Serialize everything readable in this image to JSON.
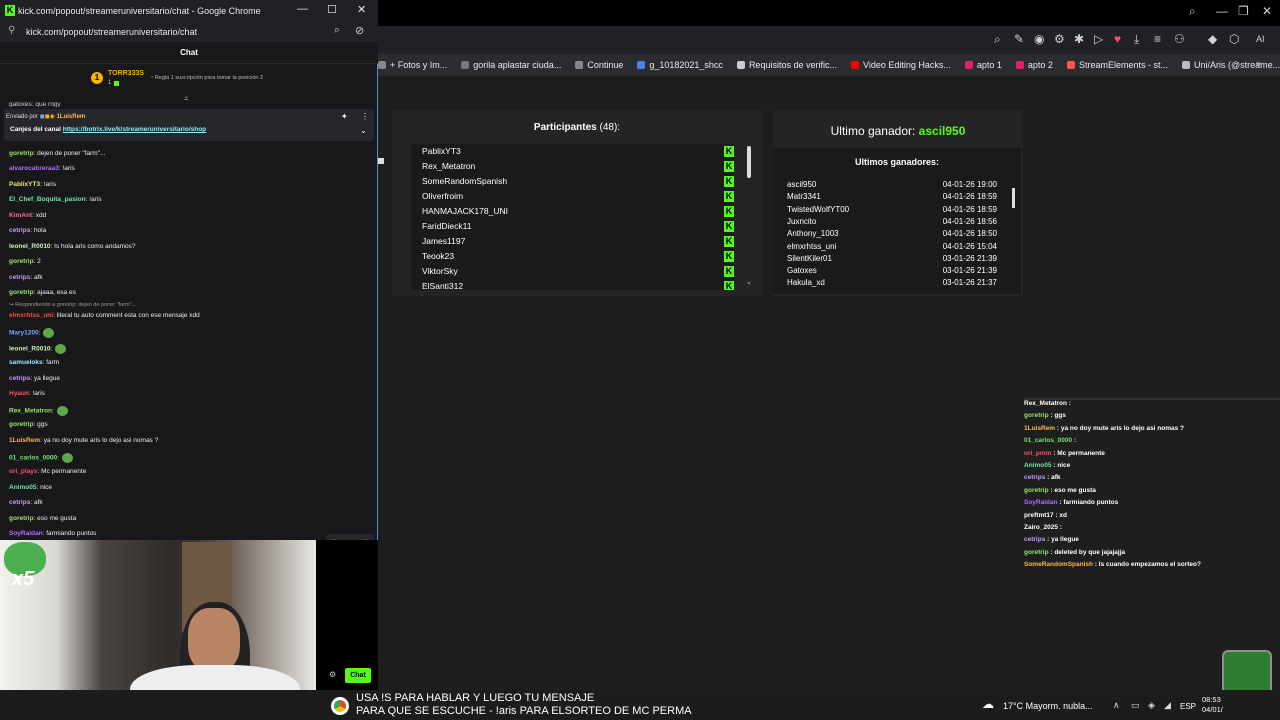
{
  "main_window": {
    "bookmarks": [
      "+ Fotos y Im...",
      "gorila aplastar ciuda...",
      "Continue",
      "g_10182021_shcc",
      "Requisitos de verific...",
      "Video Editing Hacks...",
      "apto 1",
      "apto 2",
      "StreamElements - st...",
      "Uni/Aris (@streame..."
    ],
    "bookmark_colors": [
      "#888888",
      "#777777",
      "#888888",
      "#4285f4",
      "#cccccc",
      "#ff0000",
      "#e91e63",
      "#e91e63",
      "#ff5252",
      "#bbbbbb"
    ],
    "ai_label": "AI"
  },
  "popup": {
    "title": "kick.com/popout/streameruniversitario/chat - Google Chrome",
    "url": "kick.com/popout/streameruniversitario/chat",
    "chat_header": "Chat",
    "top_user": "TORR333S",
    "top_user_count": "1",
    "rule": "Regla 1 suscripción para tomar la posición 2",
    "partial_top": "gatoxes: que rngy",
    "pinned_sent_by": "Enviado por",
    "pinned_user": "1LuisRem",
    "pinned_text": "Canjes del canal ",
    "pinned_link": "https://botrix.live/k/streameruniversitario/shop",
    "reply_note": "Respondiendo a goretrip: dejen de poner \"farm\"...",
    "chat_button": "Chat",
    "messages": [
      {
        "user": "goretrip",
        "text": ": dejen de poner \"farm\"...",
        "color": "#9ae36a"
      },
      {
        "user": "alvarocabreraa3",
        "text": ": !aris",
        "color": "#b36bff"
      },
      {
        "user": "PablixYT3",
        "text": ": !aris",
        "color": "#e7e76a"
      },
      {
        "user": "El_Chef_Boquita_pasion",
        "text": ": !aris",
        "color": "#6ee7a6"
      },
      {
        "user": "KimAnt",
        "text": ": xdd",
        "color": "#ff6b9a"
      },
      {
        "user": "cetrips",
        "text": ": hola",
        "color": "#c49bff"
      },
      {
        "user": "leonel_R0010",
        "text": ": Is hola aris como andamos?",
        "color": "#c7f7a8"
      },
      {
        "user": "goretrip",
        "text": ": 2",
        "color": "#9ae36a"
      },
      {
        "user": "cetrips",
        "text": ": afk",
        "color": "#c49bff"
      },
      {
        "user": "goretrip",
        "text": ": ajaaa, esa es",
        "color": "#9ae36a"
      },
      {
        "user": "elmxrhtss_uni",
        "text": ": literal tu auto comment esta con ese mensaje xdd",
        "color": "#ff4d4d"
      },
      {
        "user": "Mary1200",
        "text": ":",
        "color": "#6fa8ff"
      },
      {
        "user": "leonel_R0010",
        "text": ":",
        "color": "#c7f7a8"
      },
      {
        "user": "samueloks",
        "text": ": farm",
        "color": "#9ee6ff"
      },
      {
        "user": "cetrips",
        "text": ": ya llegue",
        "color": "#c49bff"
      },
      {
        "user": "Hyaun",
        "text": ": !aris",
        "color": "#ff4d6d"
      },
      {
        "user": "Rex_Metatron",
        "text": ":",
        "color": "#9ae36a"
      },
      {
        "user": "goretrip",
        "text": ": ggs",
        "color": "#9ae36a"
      },
      {
        "user": "1LuisRem",
        "text": ": ya no doy mute aris lo dejo asi nomas ?",
        "color": "#ffb84d"
      },
      {
        "user": "01_carlos_0000",
        "text": ":",
        "color": "#6ee76e"
      },
      {
        "user": "uri_plays",
        "text": ": Mc permanente",
        "color": "#ff4d6d"
      },
      {
        "user": "Animo05",
        "text": ": nice",
        "color": "#6ee7a6"
      },
      {
        "user": "cetrips",
        "text": ": afk",
        "color": "#c49bff"
      },
      {
        "user": "goretrip",
        "text": ": eso me gusta",
        "color": "#9ae36a"
      },
      {
        "user": "SoyRaidan",
        "text": ": farmiando puntos",
        "color": "#b36bff"
      }
    ]
  },
  "raffle": {
    "participants_title": "Participantes",
    "participants_count": "(48):",
    "participants": [
      "PablixYT3",
      "Rex_Metatron",
      "SomeRandomSpanish",
      "Oliverfroim",
      "HANMAJACK178_UNI",
      "FaridDieck11",
      "James1197",
      "Teook23",
      "ViktorSky",
      "ElSanti312"
    ],
    "last_winner_label": "Ultimo ganador:",
    "last_winner": "ascil950",
    "winners_title": "Ultimos ganadores:",
    "winners": [
      {
        "name": "ascil950",
        "date": "04-01-26 19:00"
      },
      {
        "name": "Matr3341",
        "date": "04-01-26 18:59"
      },
      {
        "name": "TwistedWolfYT00",
        "date": "04-01-26 18:59"
      },
      {
        "name": "Juxncito",
        "date": "04-01-26 18:56"
      },
      {
        "name": "Anthony_1003",
        "date": "04-01-26 18:50"
      },
      {
        "name": "elmxrhtss_uni",
        "date": "04-01-26 15:04"
      },
      {
        "name": "SilentKiler01",
        "date": "03-01-26 21:39"
      },
      {
        "name": "Gatoxes",
        "date": "03-01-26 21:39"
      },
      {
        "name": "Hakula_xd",
        "date": "03-01-26 21:37"
      }
    ]
  },
  "overlay_chat": [
    {
      "user": "Rex_Metatron",
      "text": " :",
      "color": "#ffffff"
    },
    {
      "user": "goretrip",
      "text": " : ggs",
      "color": "#9ae36a"
    },
    {
      "user": "1LuisRem",
      "text": " : ya no doy mute aris lo dejo asi nomas ?",
      "color": "#ffb84d"
    },
    {
      "user": "01_carlos_0000",
      "text": " :",
      "color": "#6ee76e"
    },
    {
      "user": "uri_pmm",
      "text": " : Mc permanente",
      "color": "#ff4d6d"
    },
    {
      "user": "Animo05",
      "text": " : nice",
      "color": "#6ee7a6"
    },
    {
      "user": "cetrips",
      "text": " : afk",
      "color": "#c49bff"
    },
    {
      "user": "goretrip",
      "text": " : eso me gusta",
      "color": "#9ae36a"
    },
    {
      "user": "SoyRaidan",
      "text": " : farmiando puntos",
      "color": "#b36bff"
    },
    {
      "user": "preftmt17",
      "text": " : xd",
      "color": "#ffffff"
    },
    {
      "user": "Zairo_2025",
      "text": " :",
      "color": "#ffffff"
    },
    {
      "user": "cetrips",
      "text": " : ya llegue",
      "color": "#c49bff"
    },
    {
      "user": "goretrip",
      "text": " : deleted by que jajajajja",
      "color": "#9ae36a"
    },
    {
      "user": "SomeRandomSpanish",
      "text": " : Is cuando empezamos el sorteo?",
      "color": "#ffb84d"
    }
  ],
  "webcam": {
    "multiplier": "x5"
  },
  "subtitles": "USA !S PARA HABLAR Y LUEGO TU MENSAJE\nPARA QUE SE ESCUCHE - !aris PARA ELSORTEO DE MC PERMA",
  "taskbar": {
    "weather_temp": "17°C",
    "weather_desc": "Mayorm. nubla...",
    "lang": "ESP",
    "time": "08:53",
    "date": "04/01/"
  }
}
